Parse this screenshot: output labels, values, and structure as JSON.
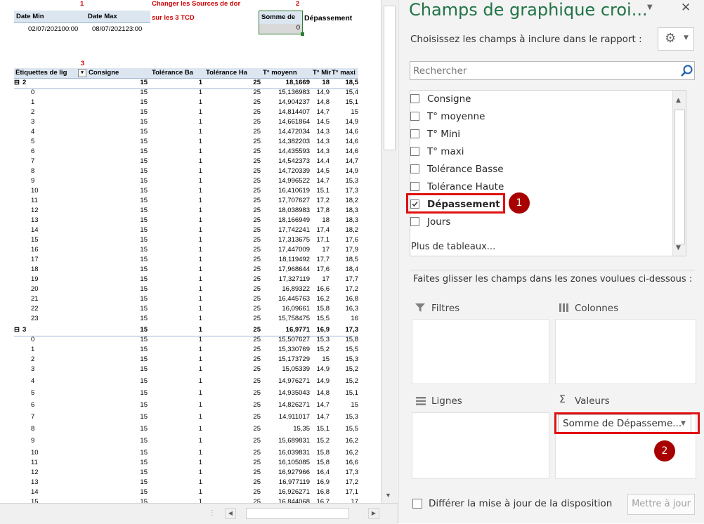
{
  "sheet": {
    "marker1": "1",
    "marker2": "2",
    "marker3": "3",
    "change_sources_l1": "Changer les Sources de dor",
    "change_sources_l2": "sur les 3 TCD",
    "date_min_label": "Date Min",
    "date_max_label": "Date Max",
    "date_min_value": "02/07/202100:00",
    "date_max_value": "08/07/202123:00",
    "somme_label": "Somme de",
    "depassement_label": "Dépassement",
    "somme_value": "0",
    "pivot_headers": [
      "Étiquettes de lig",
      "Consigne",
      "Tolérance Ba",
      "Tolérance Ha",
      "T° moyenn",
      "T° Mini",
      "T° maxi"
    ],
    "group1": {
      "label": "2",
      "consigne": "15",
      "tb": "1",
      "th": "25",
      "moy": "18,1669",
      "mini": "18",
      "maxi": "18,5"
    },
    "rows1": [
      [
        "0",
        "15",
        "1",
        "25",
        "15,136983",
        "14,9",
        "15,4"
      ],
      [
        "1",
        "15",
        "1",
        "25",
        "14,904237",
        "14,8",
        "15,1"
      ],
      [
        "2",
        "15",
        "1",
        "25",
        "14,814407",
        "14,7",
        "15"
      ],
      [
        "3",
        "15",
        "1",
        "25",
        "14,661864",
        "14,5",
        "14,9"
      ],
      [
        "4",
        "15",
        "1",
        "25",
        "14,472034",
        "14,3",
        "14,6"
      ],
      [
        "5",
        "15",
        "1",
        "25",
        "14,382203",
        "14,3",
        "14,6"
      ],
      [
        "6",
        "15",
        "1",
        "25",
        "14,435593",
        "14,3",
        "14,6"
      ],
      [
        "7",
        "15",
        "1",
        "25",
        "14,542373",
        "14,4",
        "14,7"
      ],
      [
        "8",
        "15",
        "1",
        "25",
        "14,720339",
        "14,5",
        "14,9"
      ],
      [
        "9",
        "15",
        "1",
        "25",
        "14,996522",
        "14,7",
        "15,3"
      ],
      [
        "10",
        "15",
        "1",
        "25",
        "16,410619",
        "15,1",
        "17,3"
      ],
      [
        "11",
        "15",
        "1",
        "25",
        "17,707627",
        "17,2",
        "18,2"
      ],
      [
        "12",
        "15",
        "1",
        "25",
        "18,038983",
        "17,8",
        "18,3"
      ],
      [
        "13",
        "15",
        "1",
        "25",
        "18,166949",
        "18",
        "18,3"
      ],
      [
        "14",
        "15",
        "1",
        "25",
        "17,742241",
        "17,4",
        "18,2"
      ],
      [
        "15",
        "15",
        "1",
        "25",
        "17,313675",
        "17,1",
        "17,6"
      ],
      [
        "16",
        "15",
        "1",
        "25",
        "17,447009",
        "17",
        "17,9"
      ],
      [
        "17",
        "15",
        "1",
        "25",
        "18,119492",
        "17,7",
        "18,5"
      ],
      [
        "18",
        "15",
        "1",
        "25",
        "17,968644",
        "17,6",
        "18,4"
      ],
      [
        "19",
        "15",
        "1",
        "25",
        "17,327119",
        "17",
        "17,7"
      ],
      [
        "20",
        "15",
        "1",
        "25",
        "16,89322",
        "16,6",
        "17,2"
      ],
      [
        "21",
        "15",
        "1",
        "25",
        "16,445763",
        "16,2",
        "16,8"
      ],
      [
        "22",
        "15",
        "1",
        "25",
        "16,09661",
        "15,8",
        "16,3"
      ],
      [
        "23",
        "15",
        "1",
        "25",
        "15,758475",
        "15,5",
        "16"
      ]
    ],
    "group2": {
      "label": "3",
      "consigne": "15",
      "tb": "1",
      "th": "25",
      "moy": "16,9771",
      "mini": "16,9",
      "maxi": "17,3"
    },
    "rows2": [
      [
        "0",
        "15",
        "1",
        "25",
        "15,507627",
        "15,3",
        "15,8"
      ],
      [
        "1",
        "15",
        "1",
        "25",
        "15,330769",
        "15,2",
        "15,5"
      ],
      [
        "2",
        "15",
        "1",
        "25",
        "15,173729",
        "15",
        "15,3"
      ],
      [
        "3",
        "15",
        "1",
        "25",
        "15,05339",
        "14,9",
        "15,2"
      ],
      [
        "4",
        "15",
        "1",
        "25",
        "14,976271",
        "14,9",
        "15,2"
      ],
      [
        "5",
        "15",
        "1",
        "25",
        "14,935043",
        "14,8",
        "15,1"
      ],
      [
        "6",
        "15",
        "1",
        "25",
        "14,826271",
        "14,7",
        "15"
      ],
      [
        "7",
        "15",
        "1",
        "25",
        "14,911017",
        "14,7",
        "15,3"
      ],
      [
        "8",
        "15",
        "1",
        "25",
        "15,35",
        "15,1",
        "15,5"
      ],
      [
        "9",
        "15",
        "1",
        "25",
        "15,689831",
        "15,2",
        "16,2"
      ],
      [
        "10",
        "15",
        "1",
        "25",
        "16,039831",
        "15,8",
        "16,2"
      ],
      [
        "11",
        "15",
        "1",
        "25",
        "16,105085",
        "15,8",
        "16,6"
      ],
      [
        "12",
        "15",
        "1",
        "25",
        "16,927966",
        "16,4",
        "17,3"
      ],
      [
        "13",
        "15",
        "1",
        "25",
        "16,977119",
        "16,9",
        "17,2"
      ],
      [
        "14",
        "15",
        "1",
        "25",
        "16,926271",
        "16,8",
        "17,1"
      ],
      [
        "15",
        "15",
        "1",
        "25",
        "16,844068",
        "16,7",
        "17"
      ]
    ]
  },
  "pane": {
    "title": "Champs de graphique croi...",
    "subtitle": "Choisissez les champs à inclure dans le rapport :",
    "search_placeholder": "Rechercher",
    "fields": [
      {
        "label": "Consigne",
        "checked": false
      },
      {
        "label": "T° moyenne",
        "checked": false
      },
      {
        "label": "T° Mini",
        "checked": false
      },
      {
        "label": "T° maxi",
        "checked": false
      },
      {
        "label": "Tolérance Basse",
        "checked": false
      },
      {
        "label": "Tolérance Haute",
        "checked": false
      },
      {
        "label": "Dépassement",
        "checked": true
      },
      {
        "label": "Jours",
        "checked": false
      }
    ],
    "more_tables": "Plus de tableaux...",
    "drag_hint": "Faites glisser les champs dans les zones voulues ci-dessous :",
    "zone_filtres": "Filtres",
    "zone_colonnes": "Colonnes",
    "zone_lignes": "Lignes",
    "zone_valeurs": "Valeurs",
    "values_item": "Somme de Dépasseme...",
    "defer_label": "Différer la mise à jour de la disposition",
    "update_button": "Mettre à jour",
    "callout1": "1",
    "callout2": "2"
  }
}
